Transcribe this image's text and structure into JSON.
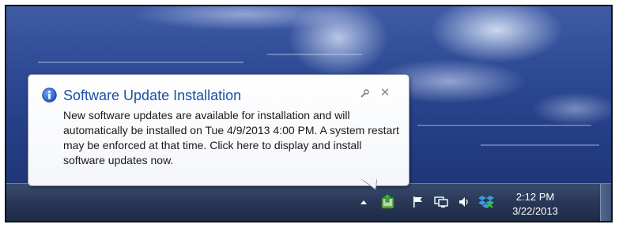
{
  "notification": {
    "title": "Software Update Installation",
    "body": "New software updates are available for installation and will automatically be installed on Tue 4/9/2013 4:00 PM. A system restart may be enforced at that time. Click here to display and install software updates now."
  },
  "taskbar": {
    "clock": {
      "time": "2:12 PM",
      "date": "3/22/2013"
    },
    "tray_icons": [
      "show-hidden-icons-arrow",
      "software-update-icon",
      "action-center-flag-icon",
      "network-icon",
      "volume-icon",
      "dropbox-icon"
    ]
  },
  "colors": {
    "title_blue": "#1c4fa3",
    "taskbar": "#2a3958",
    "desktop": "#2f4b96"
  }
}
